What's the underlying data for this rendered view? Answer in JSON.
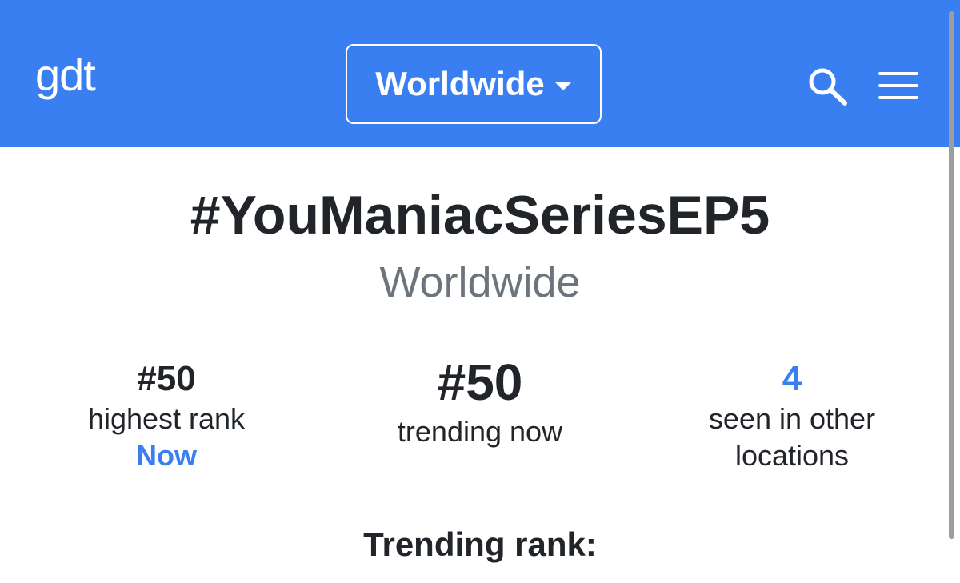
{
  "header": {
    "logo": "gdt",
    "location_selector": {
      "label": "Worldwide"
    },
    "icons": {
      "search": "search-icon",
      "menu": "hamburger-menu-icon"
    },
    "colors": {
      "bar": "#3a7ff2",
      "foreground": "#ffffff"
    }
  },
  "trend": {
    "hashtag": "#YouManiacSeriesEP5",
    "location": "Worldwide"
  },
  "stats": {
    "highest_rank": {
      "value": "#50",
      "caption": "highest rank",
      "when": "Now"
    },
    "trending_now": {
      "value": "#50",
      "caption": "trending now"
    },
    "other_locations": {
      "value": "4",
      "caption_line1": "seen in other",
      "caption_line2": "locations"
    }
  },
  "sections": {
    "trending_rank_heading": "Trending rank:"
  },
  "colors": {
    "accent": "#3a7ff2",
    "text": "#212529",
    "muted": "#6c757d"
  }
}
